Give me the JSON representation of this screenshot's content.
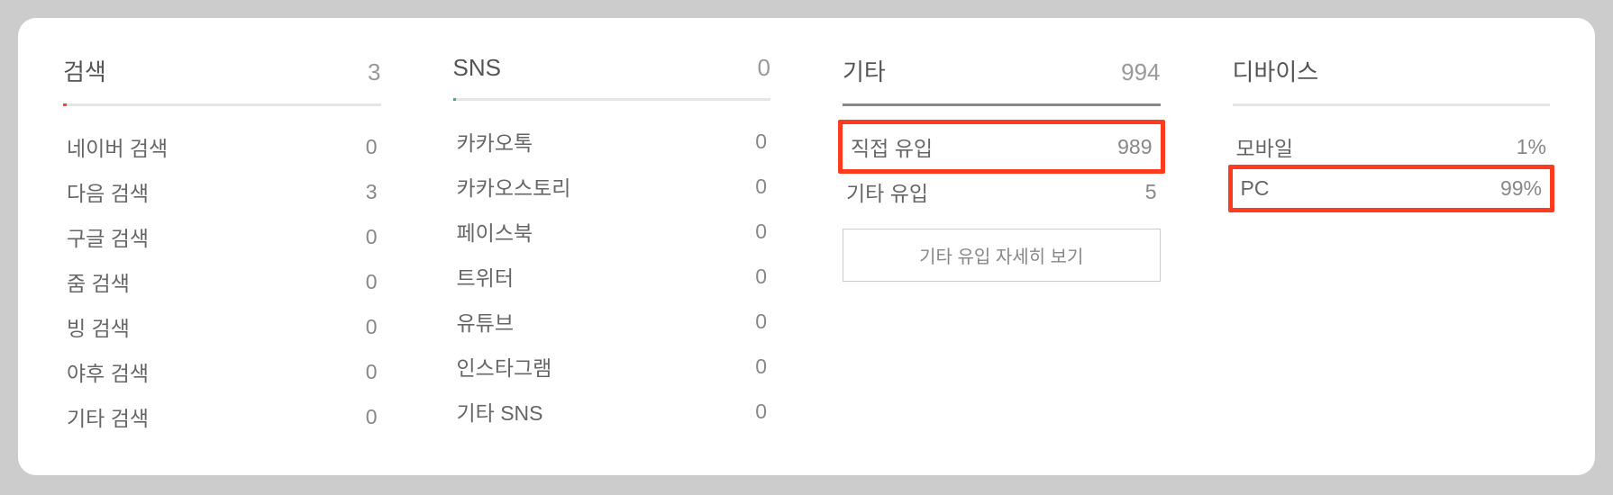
{
  "columns": {
    "search": {
      "title": "검색",
      "total": "3",
      "barColor": "red",
      "barWidth": "1%",
      "items": [
        {
          "label": "네이버 검색",
          "value": "0"
        },
        {
          "label": "다음 검색",
          "value": "3"
        },
        {
          "label": "구글 검색",
          "value": "0"
        },
        {
          "label": "줌 검색",
          "value": "0"
        },
        {
          "label": "빙 검색",
          "value": "0"
        },
        {
          "label": "야후 검색",
          "value": "0"
        },
        {
          "label": "기타 검색",
          "value": "0"
        }
      ]
    },
    "sns": {
      "title": "SNS",
      "total": "0",
      "barColor": "teal",
      "barWidth": "1%",
      "items": [
        {
          "label": "카카오톡",
          "value": "0"
        },
        {
          "label": "카카오스토리",
          "value": "0"
        },
        {
          "label": "페이스북",
          "value": "0"
        },
        {
          "label": "트위터",
          "value": "0"
        },
        {
          "label": "유튜브",
          "value": "0"
        },
        {
          "label": "인스타그램",
          "value": "0"
        },
        {
          "label": "기타 SNS",
          "value": "0"
        }
      ]
    },
    "etc": {
      "title": "기타",
      "total": "994",
      "barFull": true,
      "items": [
        {
          "label": "직접 유입",
          "value": "989",
          "highlight": true
        },
        {
          "label": "기타 유입",
          "value": "5"
        }
      ],
      "detailButton": "기타 유입 자세히 보기"
    },
    "device": {
      "title": "디바이스",
      "total": "",
      "barEmpty": true,
      "items": [
        {
          "label": "모바일",
          "value": "1%"
        },
        {
          "label": "PC",
          "value": "99%",
          "highlight": true
        }
      ]
    }
  }
}
